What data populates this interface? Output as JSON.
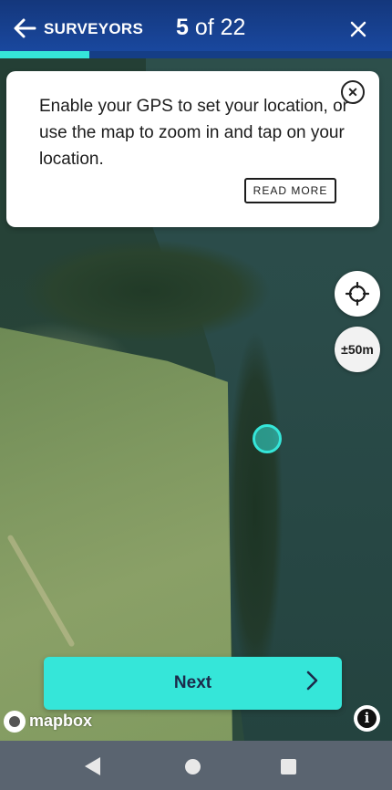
{
  "header": {
    "back_icon": "arrow-left-icon",
    "title": "SURVEYORS",
    "step_current": "5",
    "step_separator": " of ",
    "step_total": "22",
    "close_icon": "close-icon",
    "progress_fraction": 0.2273
  },
  "info_card": {
    "message": "Enable your GPS to set your location, or use the map to zoom in and tap on your location.",
    "close_icon": "close-circle-icon",
    "read_more_label": "READ MORE"
  },
  "map": {
    "locate_icon": "crosshair-icon",
    "accuracy_label": "±50m",
    "attribution": "mapbox",
    "info_icon": "info-icon"
  },
  "footer": {
    "next_label": "Next",
    "next_icon": "chevron-right-icon"
  },
  "colors": {
    "header_bg": "#1a4aa3",
    "accent": "#35e6d9",
    "nav_bar": "#5a6470"
  }
}
